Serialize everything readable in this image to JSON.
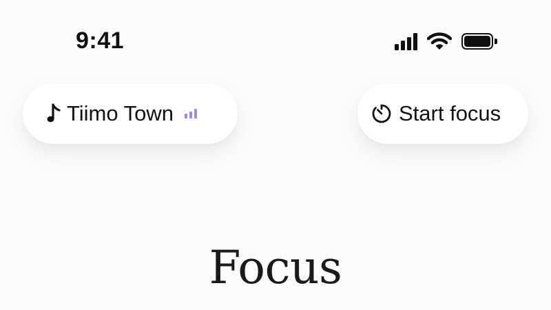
{
  "status_bar": {
    "time": "9:41",
    "icons": [
      "cellular-signal-icon",
      "wifi-icon",
      "battery-icon"
    ]
  },
  "music_pill": {
    "icon": "music-note-icon",
    "label": "Tiimo Town",
    "playing_indicator": "equalizer-icon",
    "accent_color": "#a08ad6"
  },
  "focus_pill": {
    "icon": "timer-icon",
    "label": "Start focus"
  },
  "page": {
    "title": "Focus"
  }
}
